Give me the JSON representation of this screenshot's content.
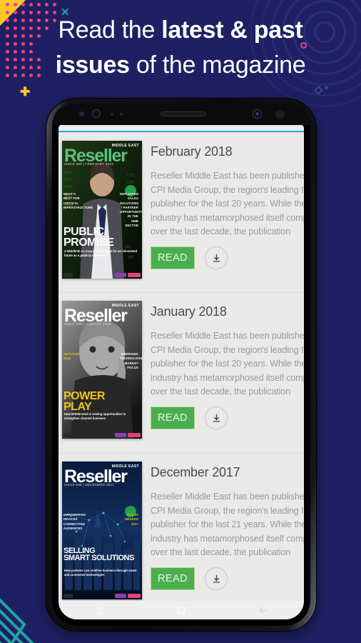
{
  "headline": {
    "line1_light": "Read the ",
    "line1_bold": "latest & past",
    "line2_bold": "issues",
    "line2_light": " of the magazine"
  },
  "colors": {
    "background_navy": "#1f2063",
    "accent_yellow": "#ffc629",
    "accent_pink": "#e8417f",
    "accent_teal": "#1fa5a0",
    "app_blue_rule": "#2ea8e6",
    "read_button_green": "#4aae4f",
    "screen_background": "#e9e9e9"
  },
  "app": {
    "cards": [
      {
        "title": "February 2018",
        "description": "Reseller Middle East has been published by CPI Media Group, the region's leading IT publisher for the last 20 years. While the IT industry has metamorphosed itself completely over the last decade, the publication continues",
        "read_label": "READ",
        "download_icon": "download-icon",
        "cover": {
          "masthead": "Reseller",
          "middle_east": "MIDDLE EAST",
          "subline": "ISSUE 260 | FEBRUARY 2018",
          "headline_line1": "PUBLIC",
          "headline_line2": "PROMISE",
          "dek": "A Middle'Ni on Avaya's game plan for an reinvented future as a publicly listed firm",
          "side_left": "WHAT'S NEXT FOR CRITICAL INFRASTRUCTURE",
          "side_right": "DEPLOYING SALES SOLUTIONS / PARTNER OPPORTUNITIES IN THE SMB SECTOR"
        }
      },
      {
        "title": "January 2018",
        "description": "Reseller Middle East has been published by CPI Media Group, the region's leading IT publisher for the last 20 years. While the IT industry has metamorphosed itself completely over the last decade, the publication continues",
        "read_label": "READ",
        "download_icon": "download-icon",
        "cover": {
          "masthead": "Reseller",
          "middle_east": "MIDDLE EAST",
          "subline": "ISSUE 259 | JANUARY 2018",
          "headline_line1": "POWER",
          "headline_line2": "PLAY",
          "dek": "How Middle East is seizing opportunities to strengthen channel business",
          "side_left": "OUTLOOK 2018",
          "side_right": "EMERGING TECHNOLOGIES / MARKET FOCUS"
        }
      },
      {
        "title": "December 2017",
        "description": "Reseller Middle East has been published by CPI Media Group, the region's leading IT publisher for the last 21 years. While the IT industry has metamorphosed itself completely over the last decade, the publication continues",
        "read_label": "READ",
        "download_icon": "download-icon",
        "cover": {
          "masthead": "Reseller",
          "middle_east": "MIDDLE EAST",
          "subline": "ISSUE 258 | DECEMBER 2017",
          "headline_line1": "SELLING",
          "headline_line2": "SMART SOLUTIONS",
          "dek": "How partners can redefine business through smart and connected technologies",
          "side_left": "EMPOWERING DEVICES CONNECTING AUDIENCES",
          "side_right": "ACE 50 AWARDS 2017"
        }
      }
    ],
    "navbar": {
      "recents_icon": "recents-icon",
      "home_icon": "home-icon",
      "back_icon": "back-arrow-icon"
    }
  }
}
